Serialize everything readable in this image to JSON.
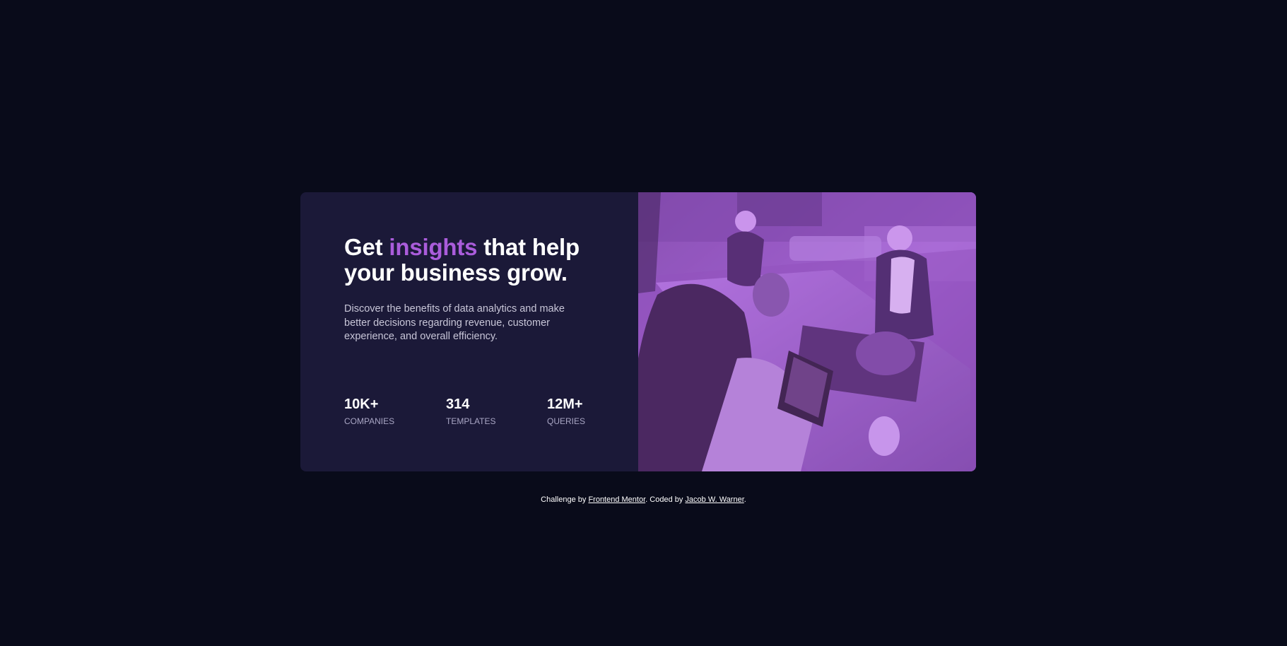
{
  "hero": {
    "headline_before": "Get ",
    "headline_accent": "insights",
    "headline_after": " that help your business grow.",
    "description": "Discover the benefits of data analytics and make better decisions regarding revenue, customer experience, and overall efficiency.",
    "stats": [
      {
        "value": "10K+",
        "label": "Companies"
      },
      {
        "value": "314",
        "label": "Templates"
      },
      {
        "value": "12M+",
        "label": "Queries"
      }
    ],
    "image_alt": "Three women working together at a desk with a laptop"
  },
  "footer": {
    "prefix": "Challenge by ",
    "link1": "Frontend Mentor",
    "middle": ". Coded by ",
    "link2": "Jacob W. Warner",
    "suffix": "."
  },
  "colors": {
    "background": "#090b1a",
    "card": "#1b1938",
    "accent": "#aa5cdb",
    "text": "#ffffff",
    "muted": "#a9a6c4"
  }
}
